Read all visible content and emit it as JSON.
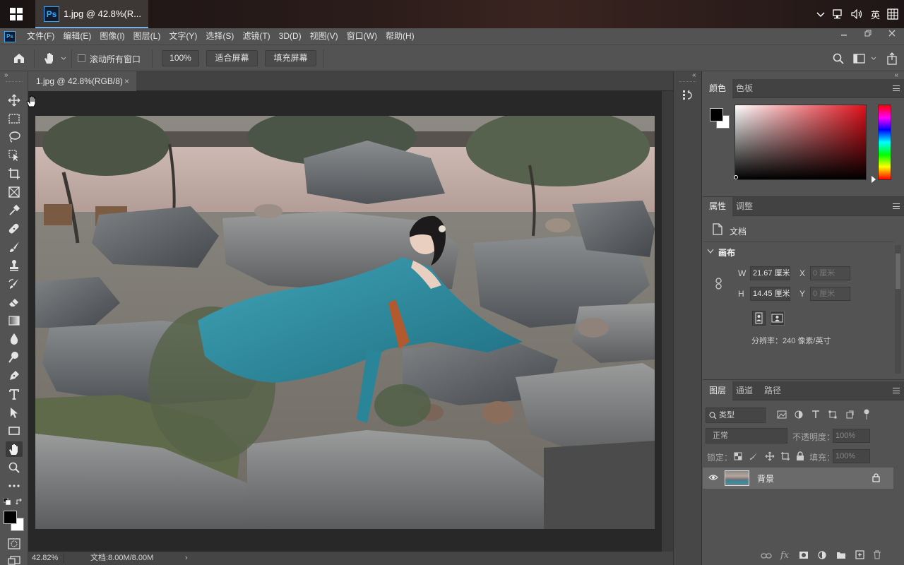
{
  "taskbar": {
    "app_title": "1.jpg @ 42.8%(R...",
    "ime": "英",
    "icons": [
      "chevron-up-icon",
      "network-icon",
      "volume-icon",
      "keyboard-grid-icon"
    ]
  },
  "menubar": {
    "items": [
      "文件(F)",
      "编辑(E)",
      "图像(I)",
      "图层(L)",
      "文字(Y)",
      "选择(S)",
      "滤镜(T)",
      "3D(D)",
      "视图(V)",
      "窗口(W)",
      "帮助(H)"
    ],
    "window_controls": [
      "minimize",
      "restore",
      "close"
    ]
  },
  "options": {
    "scroll_all_label": "滚动所有窗口",
    "scroll_all_checked": false,
    "zoom_value": "100%",
    "fit_screen": "适合屏幕",
    "fill_screen": "填充屏幕"
  },
  "document": {
    "tab_title": "1.jpg @ 42.8%(RGB/8)",
    "zoom": "42.82%",
    "doc_size": "文档:8.00M/8.00M"
  },
  "color_panel": {
    "tabs": [
      "颜色",
      "色板"
    ],
    "active_tab": "颜色",
    "foreground": "#000000",
    "background": "#ffffff",
    "hue_color": "#e02020"
  },
  "properties_panel": {
    "tabs": [
      "属性",
      "调整"
    ],
    "active_tab": "属性",
    "doc_label": "文档",
    "section": "画布",
    "w_label": "W",
    "w_value": "21.67 厘米",
    "h_label": "H",
    "h_value": "14.45 厘米",
    "x_label": "X",
    "x_value": "0 厘米",
    "y_label": "Y",
    "y_value": "0 厘米",
    "resolution": "分辨率：240 像素/英寸"
  },
  "layers_panel": {
    "tabs": [
      "图层",
      "通道",
      "路径"
    ],
    "active_tab": "图层",
    "filter_kind": "类型",
    "blend_mode": "正常",
    "opacity_label": "不透明度：",
    "opacity_value": "100%",
    "lock_label": "锁定：",
    "fill_label": "填充：",
    "fill_value": "100%",
    "layers": [
      {
        "name": "背景",
        "visible": true,
        "locked": true
      }
    ],
    "bottom_icons": [
      "link-icon",
      "fx-icon",
      "mask-icon",
      "adjustment-icon",
      "folder-icon",
      "new-layer-icon",
      "trash-icon"
    ]
  },
  "toolbar": {
    "tools": [
      "move-tool",
      "marquee-tool",
      "lasso-tool",
      "object-select-tool",
      "crop-tool",
      "frame-tool",
      "eyedropper-tool",
      "healing-brush-tool",
      "brush-tool",
      "clone-stamp-tool",
      "history-brush-tool",
      "eraser-tool",
      "gradient-tool",
      "blur-tool",
      "dodge-tool",
      "pen-tool",
      "type-tool",
      "path-select-tool",
      "rectangle-tool",
      "hand-tool",
      "zoom-tool",
      "more-tools"
    ],
    "active_tool": "hand-tool"
  }
}
